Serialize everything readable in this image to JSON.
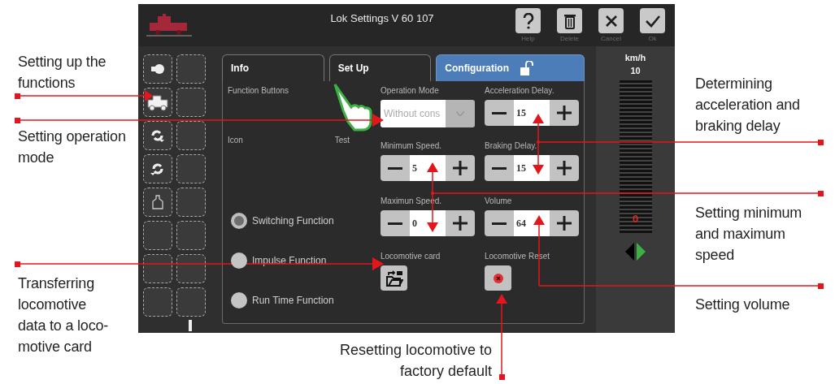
{
  "annotations_left": [
    "Setting up the functions",
    "Setting operation mode",
    "Transferring locomotive data to a loco-motive card"
  ],
  "annotations_right": [
    "Determining acceleration and braking delay",
    "Setting minimum and maximum speed",
    "Setting volume"
  ],
  "annotation_bottom": "Resetting locomotive to factory default",
  "window": {
    "title": "Lok Settings V 60 107"
  },
  "toolbar": [
    {
      "kind": "help",
      "label": "Help"
    },
    {
      "kind": "delete",
      "label": "Delete"
    },
    {
      "kind": "cancel",
      "label": "Cancel"
    },
    {
      "kind": "ok",
      "label": "Ok"
    }
  ],
  "function_slots": [
    {
      "kind": "light"
    },
    {
      "kind": "empty"
    },
    {
      "kind": "loco"
    },
    {
      "kind": "empty"
    },
    {
      "kind": "rotate-right"
    },
    {
      "kind": "empty"
    },
    {
      "kind": "rotate-left"
    },
    {
      "kind": "empty"
    },
    {
      "kind": "bottle"
    },
    {
      "kind": "empty"
    },
    {
      "kind": "empty"
    },
    {
      "kind": "empty"
    },
    {
      "kind": "empty"
    },
    {
      "kind": "empty"
    },
    {
      "kind": "empty"
    },
    {
      "kind": "empty"
    }
  ],
  "tabs": [
    {
      "label": "Info",
      "selected": false
    },
    {
      "label": "Set Up",
      "selected": false
    },
    {
      "label": "Configuration",
      "selected": true,
      "unlocked": true
    }
  ],
  "function_buttons": {
    "title": "Function Buttons",
    "icon_header": "Icon",
    "test_header": "Test",
    "types": [
      {
        "label": "Switching Function",
        "selected": true
      },
      {
        "label": "Impulse Function",
        "selected": false
      },
      {
        "label": "Run Time Function",
        "selected": false
      }
    ]
  },
  "settings_middle": [
    {
      "kind": "dropdown",
      "label": "Operation Mode",
      "value": "Without cons"
    },
    {
      "kind": "stepper",
      "label": "Minimum Speed.",
      "value": "5"
    },
    {
      "kind": "stepper",
      "label": "Maximun Speed.",
      "value": "0"
    },
    {
      "kind": "card",
      "label": "Locomotive card"
    }
  ],
  "settings_right": [
    {
      "kind": "stepper",
      "label": "Acceleration Delay.",
      "value": "15"
    },
    {
      "kind": "stepper",
      "label": "Braking Delay.",
      "value": "15"
    },
    {
      "kind": "stepper",
      "label": "Volume",
      "value": "64"
    },
    {
      "kind": "reset",
      "label": "Locomotive Reset"
    }
  ],
  "speed": {
    "unit": "km/h",
    "max": "10",
    "reading": "0",
    "level": 0,
    "forward": true
  }
}
